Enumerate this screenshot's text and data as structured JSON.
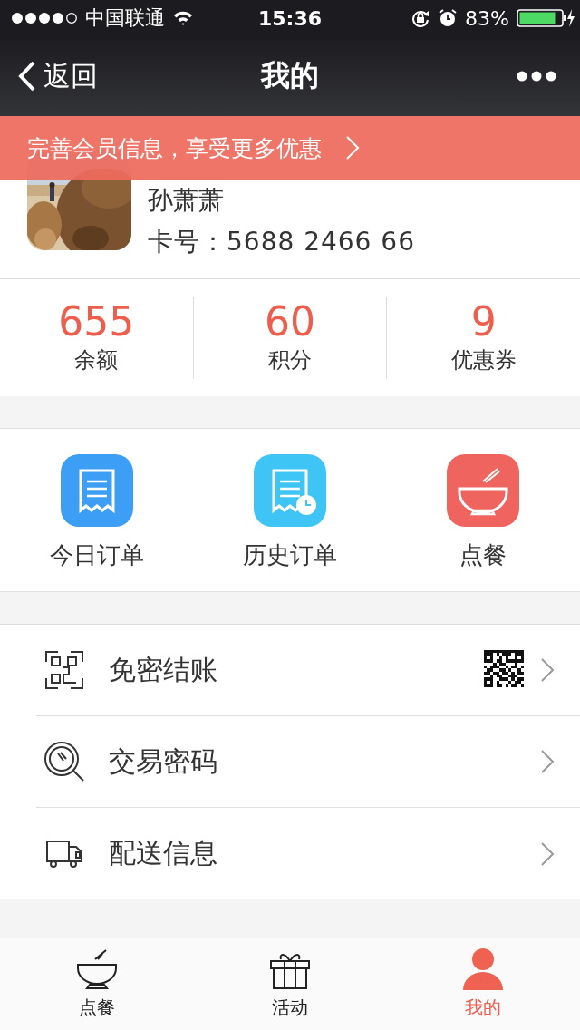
{
  "status_bar": {
    "carrier": "中国联通",
    "time": "15:36",
    "battery": "83%"
  },
  "nav": {
    "back": "返回",
    "title": "我的"
  },
  "banner": {
    "text": "完善会员信息，享受更多优惠"
  },
  "profile": {
    "name": "孙萧萧",
    "card": "卡号：5688 2466 66"
  },
  "stats": [
    {
      "value": "655",
      "label": "余额"
    },
    {
      "value": "60",
      "label": "积分"
    },
    {
      "value": "9",
      "label": "优惠券"
    }
  ],
  "shortcuts": [
    {
      "label": "今日订单",
      "kind": "today",
      "color": "#3d9ef5"
    },
    {
      "label": "历史订单",
      "kind": "history",
      "color": "#3ec5f6"
    },
    {
      "label": "点餐",
      "kind": "order",
      "color": "#f0645f"
    }
  ],
  "menu": [
    {
      "label": "免密结账",
      "kind": "scan",
      "qr_code": true
    },
    {
      "label": "交易密码",
      "kind": "password",
      "qr_code": false
    },
    {
      "label": "配送信息",
      "kind": "delivery",
      "qr_code": false
    }
  ],
  "tabs": [
    {
      "label": "点餐",
      "kind": "bowl",
      "selected": false
    },
    {
      "label": "活动",
      "kind": "gift",
      "selected": false
    },
    {
      "label": "我的",
      "kind": "person",
      "selected": true
    }
  ]
}
